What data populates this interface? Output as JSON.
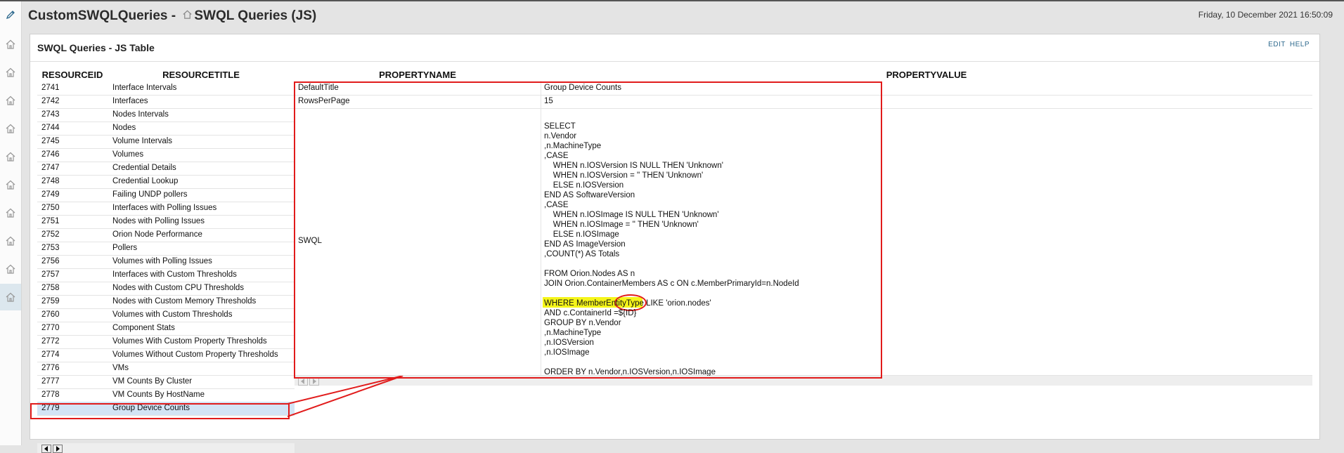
{
  "header": {
    "title_main": "CustomSWQLQueries - ",
    "title_view": "SWQL Queries (JS)",
    "date": "Friday, 10 December 2021 16:50:09"
  },
  "nav": {
    "icons": [
      "edit-icon",
      "home-icon",
      "home-icon",
      "home-icon",
      "home-icon",
      "home-icon",
      "home-icon",
      "home-icon",
      "home-icon",
      "home-icon",
      "home-icon"
    ]
  },
  "panel": {
    "title": "SWQL Queries - JS Table",
    "edit_label": "EDIT",
    "help_label": "HELP"
  },
  "resources": {
    "columns": [
      "RESOURCEID",
      "RESOURCETITLE"
    ],
    "rows": [
      {
        "id": "2741",
        "title": "Interface Intervals"
      },
      {
        "id": "2742",
        "title": "Interfaces"
      },
      {
        "id": "2743",
        "title": "Nodes Intervals"
      },
      {
        "id": "2744",
        "title": "Nodes"
      },
      {
        "id": "2745",
        "title": "Volume Intervals"
      },
      {
        "id": "2746",
        "title": "Volumes"
      },
      {
        "id": "2747",
        "title": "Credential Details"
      },
      {
        "id": "2748",
        "title": "Credential Lookup"
      },
      {
        "id": "2749",
        "title": "Failing UNDP pollers"
      },
      {
        "id": "2750",
        "title": "Interfaces with Polling Issues"
      },
      {
        "id": "2751",
        "title": "Nodes with Polling Issues"
      },
      {
        "id": "2752",
        "title": "Orion Node Performance"
      },
      {
        "id": "2753",
        "title": "Pollers"
      },
      {
        "id": "2756",
        "title": "Volumes with Polling Issues"
      },
      {
        "id": "2757",
        "title": "Interfaces with Custom Thresholds"
      },
      {
        "id": "2758",
        "title": "Nodes with Custom CPU Thresholds"
      },
      {
        "id": "2759",
        "title": "Nodes with Custom Memory Thresholds"
      },
      {
        "id": "2760",
        "title": "Volumes with Custom Thresholds"
      },
      {
        "id": "2770",
        "title": "Component Stats"
      },
      {
        "id": "2772",
        "title": "Volumes With Custom Property Thresholds"
      },
      {
        "id": "2774",
        "title": "Volumes Without Custom Property Thresholds"
      },
      {
        "id": "2776",
        "title": "VMs"
      },
      {
        "id": "2777",
        "title": "VM Counts By Cluster"
      },
      {
        "id": "2778",
        "title": "VM Counts By HostName"
      },
      {
        "id": "2779",
        "title": "Group Device Counts"
      }
    ],
    "selected_id": "2779"
  },
  "properties": {
    "columns": [
      "PROPERTYNAME",
      "PROPERTYVALUE"
    ],
    "rows": [
      {
        "name": "DefaultTitle",
        "value": "Group Device Counts"
      },
      {
        "name": "RowsPerPage",
        "value": "15"
      },
      {
        "name": "SWQL",
        "value": "SELECT\nn.Vendor\n,n.MachineType\n,CASE\n    WHEN n.IOSVersion IS NULL THEN 'Unknown'\n    WHEN n.IOSVersion = '' THEN 'Unknown'\n    ELSE n.IOSVersion\nEND AS SoftwareVersion\n,CASE\n    WHEN n.IOSImage IS NULL THEN 'Unknown'\n    WHEN n.IOSImage = '' THEN 'Unknown'\n    ELSE n.IOSImage\nEND AS ImageVersion\n,COUNT(*) AS Totals\n\nFROM Orion.Nodes AS n\nJOIN Orion.ContainerMembers AS c ON c.MemberPrimaryId=n.NodeId\n\nWHERE MemberEntityType LIKE 'orion.nodes'\nAND c.ContainerId =${ID}\nGROUP BY n.Vendor\n,n.MachineType\n,n.IOSVersion\n,n.IOSImage\n\nORDER BY n.Vendor,n.IOSVersion,n.IOSImage"
      }
    ]
  }
}
